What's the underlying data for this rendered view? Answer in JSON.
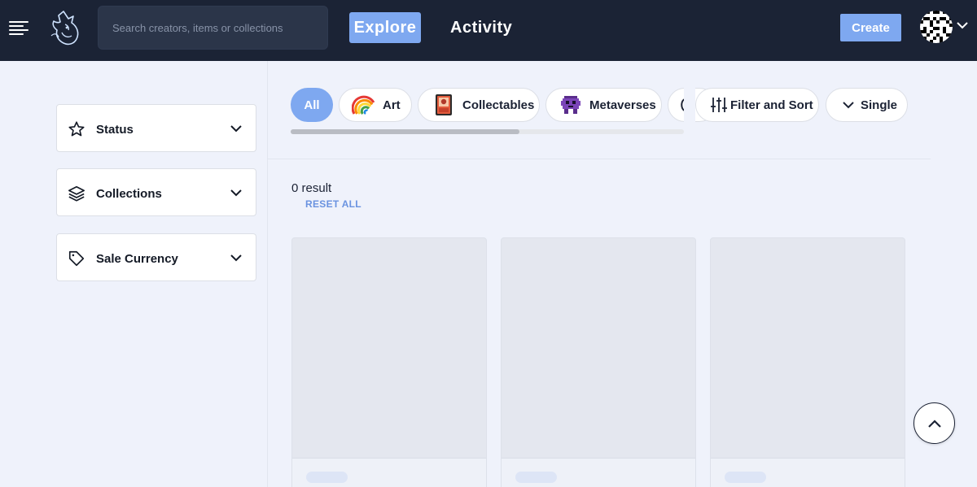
{
  "header": {
    "search_placeholder": "Search creators, items or collections",
    "nav_explore": "Explore",
    "nav_activity": "Activity",
    "create_label": "Create"
  },
  "sidebar": {
    "filters": [
      {
        "label": "Status",
        "icon": "star-icon"
      },
      {
        "label": "Collections",
        "icon": "layers-icon"
      },
      {
        "label": "Sale Currency",
        "icon": "tag-icon"
      }
    ]
  },
  "categories": {
    "items": [
      {
        "label": "All",
        "icon": "",
        "selected": true
      },
      {
        "label": "Art",
        "icon": "rainbow-icon",
        "selected": false
      },
      {
        "label": "Collectables",
        "icon": "card-icon",
        "selected": false
      },
      {
        "label": "Metaverses",
        "icon": "alien-icon",
        "selected": false
      }
    ]
  },
  "toolbar": {
    "filter_sort_label": "Filter and Sort",
    "view_label": "Single"
  },
  "results": {
    "count_text": "0 result",
    "reset_label": "RESET ALL"
  },
  "colors": {
    "header_bg": "#1b2335",
    "accent": "#7ea8f0",
    "page_bg": "#eff2fb"
  }
}
